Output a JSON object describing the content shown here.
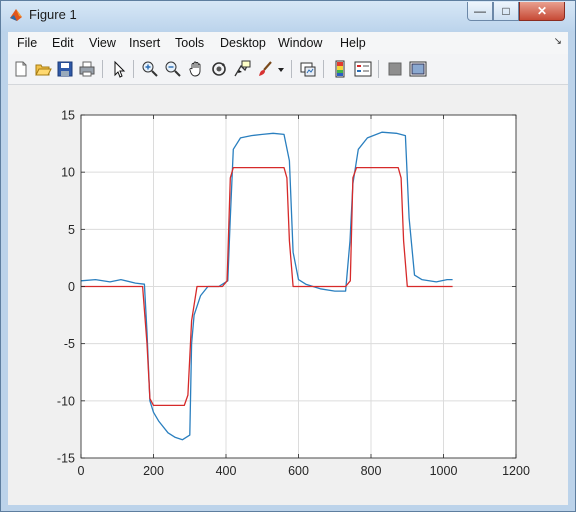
{
  "window": {
    "title": "Figure 1"
  },
  "title_buttons": {
    "minimize": "—",
    "maximize": "□",
    "close": "✕"
  },
  "menu": {
    "items": [
      "File",
      "Edit",
      "View",
      "Insert",
      "Tools",
      "Desktop",
      "Window",
      "Help"
    ],
    "overflow": "↘"
  },
  "toolbar": {
    "icons": [
      "new-figure-icon",
      "open-file-icon",
      "save-icon",
      "print-icon",
      "pointer-icon",
      "zoom-in-icon",
      "zoom-out-icon",
      "pan-hand-icon",
      "rotate-3d-icon",
      "data-cursor-icon",
      "brush-icon",
      "brush-dropdown-icon",
      "link-plot-icon",
      "colorbar-icon",
      "legend-icon",
      "hide-plot-tools-icon",
      "show-plot-tools-icon"
    ]
  },
  "colors": {
    "series_blue": "#2a7fbf",
    "series_red": "#d62a2a",
    "grid": "#dcdcdc",
    "axes_bg": "#ffffff"
  },
  "chart_data": {
    "type": "line",
    "title": "",
    "xlabel": "",
    "ylabel": "",
    "xlim": [
      0,
      1200
    ],
    "ylim": [
      -15,
      15
    ],
    "xticks": [
      0,
      200,
      400,
      600,
      800,
      1000,
      1200
    ],
    "yticks": [
      -15,
      -10,
      -5,
      0,
      5,
      10,
      15
    ],
    "grid": true,
    "series": [
      {
        "color": "#2a7fbf",
        "x": [
          0,
          40,
          80,
          110,
          150,
          175,
          182,
          190,
          200,
          215,
          240,
          260,
          280,
          300,
          305,
          312,
          330,
          350,
          380,
          405,
          412,
          420,
          440,
          470,
          500,
          530,
          560,
          575,
          585,
          600,
          620,
          660,
          700,
          730,
          742,
          750,
          765,
          790,
          830,
          870,
          895,
          905,
          920,
          940,
          980,
          1010,
          1025
        ],
        "y": [
          0.5,
          0.6,
          0.4,
          0.6,
          0.3,
          0.2,
          -4.0,
          -10.0,
          -11.0,
          -11.8,
          -12.8,
          -13.2,
          -13.4,
          -13.0,
          -5.0,
          -2.5,
          -0.8,
          0.0,
          0.0,
          0.5,
          6.0,
          12.0,
          13.0,
          13.2,
          13.3,
          13.4,
          13.3,
          11.0,
          3.0,
          0.6,
          0.2,
          -0.2,
          -0.4,
          -0.4,
          4.0,
          9.0,
          12.0,
          13.0,
          13.5,
          13.4,
          13.2,
          6.0,
          1.0,
          0.6,
          0.4,
          0.6,
          0.6
        ]
      },
      {
        "color": "#d62a2a",
        "x": [
          0,
          170,
          182,
          190,
          200,
          285,
          295,
          305,
          320,
          390,
          403,
          412,
          420,
          560,
          568,
          575,
          585,
          730,
          743,
          750,
          760,
          875,
          883,
          890,
          900,
          1025
        ],
        "y": [
          0,
          0,
          -5,
          -9.8,
          -10.4,
          -10.4,
          -9.5,
          -3.0,
          0,
          0,
          0.5,
          9.5,
          10.4,
          10.4,
          9.5,
          4.0,
          0,
          0,
          0.5,
          9.5,
          10.4,
          10.4,
          9.5,
          4.0,
          0,
          0
        ]
      }
    ]
  }
}
